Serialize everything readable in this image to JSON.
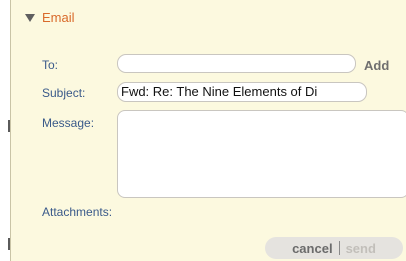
{
  "section": {
    "title": "Email"
  },
  "form": {
    "to_label": "To:",
    "to_value": "",
    "add_label": "Add",
    "subject_label": "Subject:",
    "subject_value": "Fwd: Re: The Nine Elements of Di",
    "message_label": "Message:",
    "message_value": "",
    "attachments_label": "Attachments:"
  },
  "actions": {
    "cancel_label": "cancel",
    "send_label": "send"
  },
  "colors": {
    "panel_bg": "#fcf9df",
    "title_accent": "#d96a2b",
    "label_text": "#3a5a8a",
    "button_bg": "#e5e3df"
  }
}
